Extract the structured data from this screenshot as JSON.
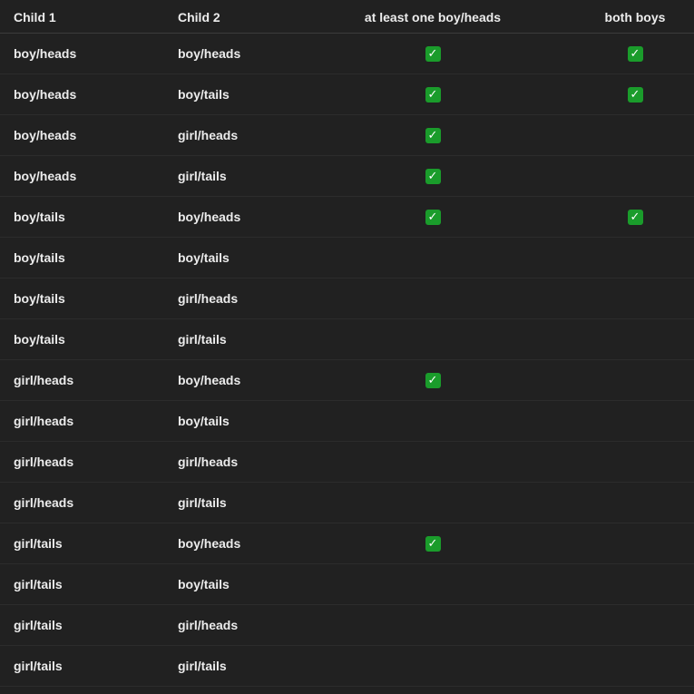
{
  "table": {
    "headers": [
      "Child 1",
      "Child 2",
      "at least one boy/heads",
      "both boys"
    ],
    "check_glyph": "✓",
    "rows": [
      {
        "child1": "boy/heads",
        "child2": "boy/heads",
        "at_least_one": true,
        "both_boys": true
      },
      {
        "child1": "boy/heads",
        "child2": "boy/tails",
        "at_least_one": true,
        "both_boys": true
      },
      {
        "child1": "boy/heads",
        "child2": "girl/heads",
        "at_least_one": true,
        "both_boys": false
      },
      {
        "child1": "boy/heads",
        "child2": "girl/tails",
        "at_least_one": true,
        "both_boys": false
      },
      {
        "child1": "boy/tails",
        "child2": "boy/heads",
        "at_least_one": true,
        "both_boys": true
      },
      {
        "child1": "boy/tails",
        "child2": "boy/tails",
        "at_least_one": false,
        "both_boys": false
      },
      {
        "child1": "boy/tails",
        "child2": "girl/heads",
        "at_least_one": false,
        "both_boys": false
      },
      {
        "child1": "boy/tails",
        "child2": "girl/tails",
        "at_least_one": false,
        "both_boys": false
      },
      {
        "child1": "girl/heads",
        "child2": "boy/heads",
        "at_least_one": true,
        "both_boys": false
      },
      {
        "child1": "girl/heads",
        "child2": "boy/tails",
        "at_least_one": false,
        "both_boys": false
      },
      {
        "child1": "girl/heads",
        "child2": "girl/heads",
        "at_least_one": false,
        "both_boys": false
      },
      {
        "child1": "girl/heads",
        "child2": "girl/tails",
        "at_least_one": false,
        "both_boys": false
      },
      {
        "child1": "girl/tails",
        "child2": "boy/heads",
        "at_least_one": true,
        "both_boys": false
      },
      {
        "child1": "girl/tails",
        "child2": "boy/tails",
        "at_least_one": false,
        "both_boys": false
      },
      {
        "child1": "girl/tails",
        "child2": "girl/heads",
        "at_least_one": false,
        "both_boys": false
      },
      {
        "child1": "girl/tails",
        "child2": "girl/tails",
        "at_least_one": false,
        "both_boys": false
      }
    ]
  },
  "colors": {
    "background": "#212121",
    "text": "#ececec",
    "check_green": "#1a9c2b"
  },
  "icons": {
    "check": "check-mark-button-icon"
  }
}
